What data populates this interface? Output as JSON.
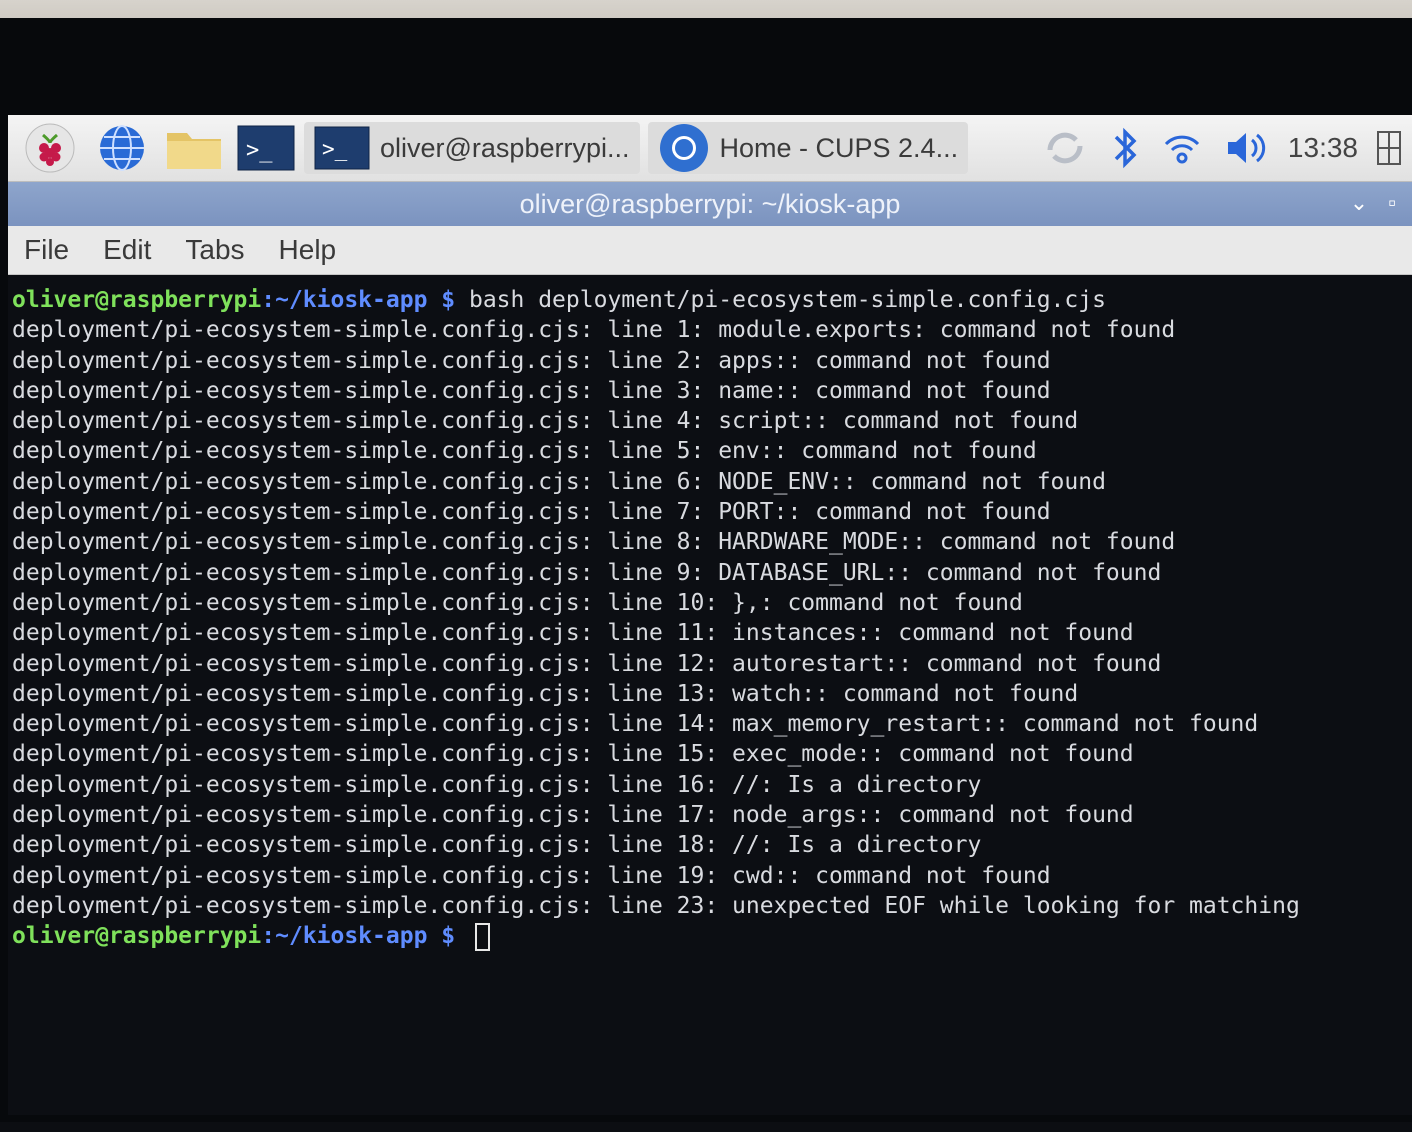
{
  "taskbar": {
    "task_terminal": "oliver@raspberrypi...",
    "task_browser": "Home - CUPS 2.4...",
    "clock": "13:38"
  },
  "window": {
    "title": "oliver@raspberrypi: ~/kiosk-app",
    "menu": [
      "File",
      "Edit",
      "Tabs",
      "Help"
    ]
  },
  "terminal": {
    "prompt_user": "oliver@raspberrypi",
    "prompt_path": ":~/kiosk-app",
    "prompt_symbol": " $ ",
    "command": "bash deployment/pi-ecosystem-simple.config.cjs",
    "output": [
      "deployment/pi-ecosystem-simple.config.cjs: line 1: module.exports: command not found",
      "deployment/pi-ecosystem-simple.config.cjs: line 2: apps:: command not found",
      "deployment/pi-ecosystem-simple.config.cjs: line 3: name:: command not found",
      "deployment/pi-ecosystem-simple.config.cjs: line 4: script:: command not found",
      "deployment/pi-ecosystem-simple.config.cjs: line 5: env:: command not found",
      "deployment/pi-ecosystem-simple.config.cjs: line 6: NODE_ENV:: command not found",
      "deployment/pi-ecosystem-simple.config.cjs: line 7: PORT:: command not found",
      "deployment/pi-ecosystem-simple.config.cjs: line 8: HARDWARE_MODE:: command not found",
      "deployment/pi-ecosystem-simple.config.cjs: line 9: DATABASE_URL:: command not found",
      "deployment/pi-ecosystem-simple.config.cjs: line 10: },: command not found",
      "deployment/pi-ecosystem-simple.config.cjs: line 11: instances:: command not found",
      "deployment/pi-ecosystem-simple.config.cjs: line 12: autorestart:: command not found",
      "deployment/pi-ecosystem-simple.config.cjs: line 13: watch:: command not found",
      "deployment/pi-ecosystem-simple.config.cjs: line 14: max_memory_restart:: command not found",
      "deployment/pi-ecosystem-simple.config.cjs: line 15: exec_mode:: command not found",
      "deployment/pi-ecosystem-simple.config.cjs: line 16: //: Is a directory",
      "deployment/pi-ecosystem-simple.config.cjs: line 17: node_args:: command not found",
      "deployment/pi-ecosystem-simple.config.cjs: line 18: //: Is a directory",
      "deployment/pi-ecosystem-simple.config.cjs: line 19: cwd:: command not found",
      "deployment/pi-ecosystem-simple.config.cjs: line 23: unexpected EOF while looking for matching"
    ]
  }
}
